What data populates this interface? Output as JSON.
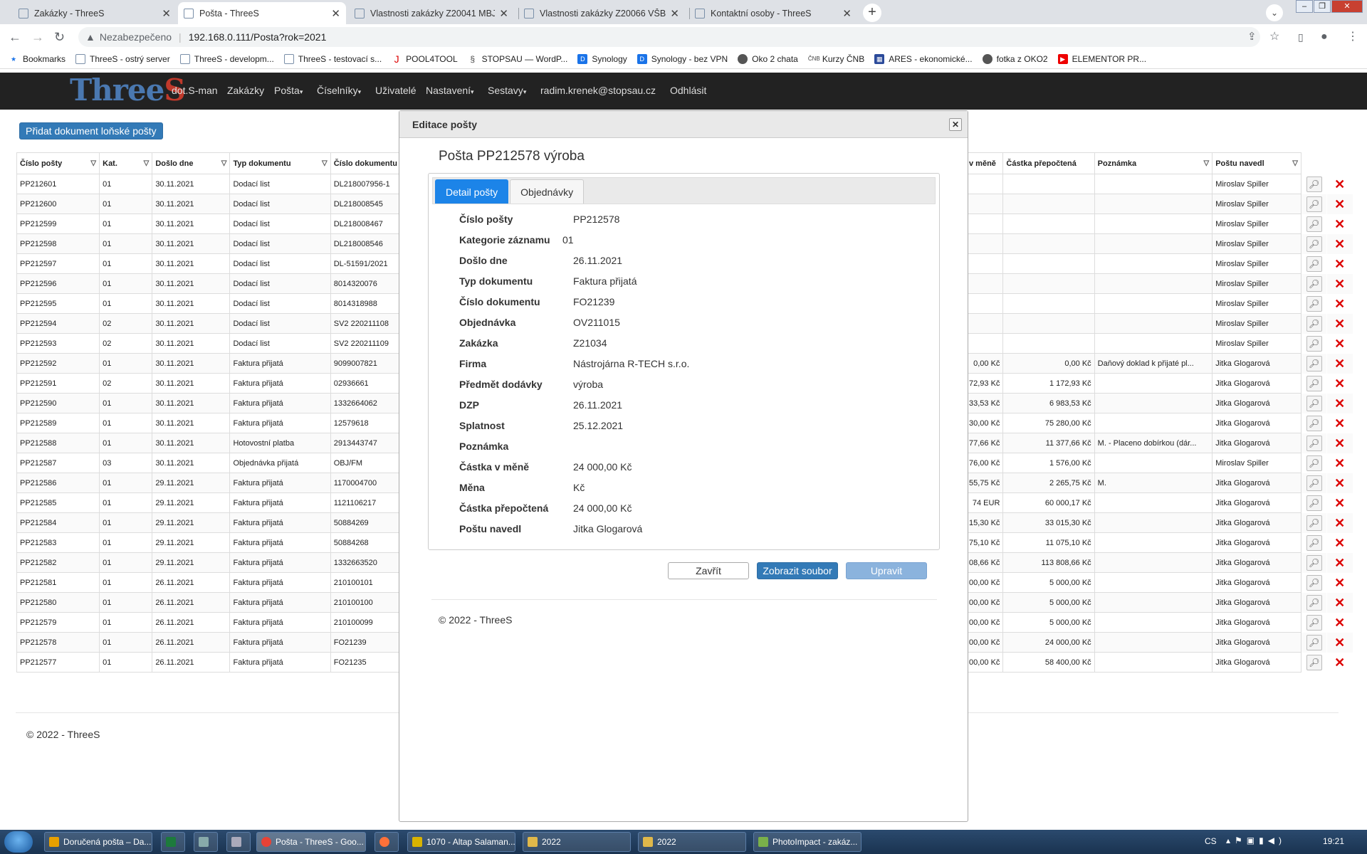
{
  "browser": {
    "tabs": [
      {
        "title": "Zakázky - ThreeS",
        "active": false
      },
      {
        "title": "Pošta - ThreeS",
        "active": true
      },
      {
        "title": "Vlastnosti zakázky Z20041 MBJZ",
        "active": false
      },
      {
        "title": "Vlastnosti zakázky Z20066 VŠB -",
        "active": false
      },
      {
        "title": "Kontaktní osoby - ThreeS",
        "active": false
      }
    ],
    "security_label": "Nezabezpečeno",
    "url": "192.168.0.111/Posta?rok=2021",
    "bookmarks": [
      "Bookmarks",
      "ThreeS - ostrý server",
      "ThreeS - developm...",
      "ThreeS - testovací s...",
      "POOL4TOOL",
      "STOPSAU — WordP...",
      "Synology",
      "Synology - bez VPN",
      "Oko 2 chata",
      "Kurzy ČNB",
      "ARES - ekonomické...",
      "fotka z OKO2",
      "ELEMENTOR PR..."
    ]
  },
  "app": {
    "logo_main": "Three",
    "logo_accent": "S",
    "nav": [
      "dot.S-man",
      "Zakázky",
      "Pošta",
      "Číselníky",
      "Uživatelé",
      "Nastavení",
      "Sestavy",
      "radim.krenek@stopsau.cz",
      "Odhlásit"
    ]
  },
  "page": {
    "add_button": "Přidat dokument loňské pošty",
    "footer": "© 2022 - ThreeS"
  },
  "grid_left": {
    "headers": [
      "Číslo pošty",
      "Kat.",
      "Došlo dne",
      "Typ dokumentu",
      "Číslo dokumentu"
    ],
    "rows": [
      [
        "PP212601",
        "01",
        "30.11.2021",
        "Dodací list",
        "DL218007956-1"
      ],
      [
        "PP212600",
        "01",
        "30.11.2021",
        "Dodací list",
        "DL218008545"
      ],
      [
        "PP212599",
        "01",
        "30.11.2021",
        "Dodací list",
        "DL218008467"
      ],
      [
        "PP212598",
        "01",
        "30.11.2021",
        "Dodací list",
        "DL218008546"
      ],
      [
        "PP212597",
        "01",
        "30.11.2021",
        "Dodací list",
        "DL-51591/2021"
      ],
      [
        "PP212596",
        "01",
        "30.11.2021",
        "Dodací list",
        "8014320076"
      ],
      [
        "PP212595",
        "01",
        "30.11.2021",
        "Dodací list",
        "8014318988"
      ],
      [
        "PP212594",
        "02",
        "30.11.2021",
        "Dodací list",
        "SV2 220211108"
      ],
      [
        "PP212593",
        "02",
        "30.11.2021",
        "Dodací list",
        "SV2 220211109"
      ],
      [
        "PP212592",
        "01",
        "30.11.2021",
        "Faktura přijatá",
        "9099007821"
      ],
      [
        "PP212591",
        "02",
        "30.11.2021",
        "Faktura přijatá",
        "02936661"
      ],
      [
        "PP212590",
        "01",
        "30.11.2021",
        "Faktura přijatá",
        "1332664062"
      ],
      [
        "PP212589",
        "01",
        "30.11.2021",
        "Faktura přijatá",
        "12579618"
      ],
      [
        "PP212588",
        "01",
        "30.11.2021",
        "Hotovostní platba",
        "2913443747"
      ],
      [
        "PP212587",
        "03",
        "30.11.2021",
        "Objednávka přijatá",
        "OBJ/FM"
      ],
      [
        "PP212586",
        "01",
        "29.11.2021",
        "Faktura přijatá",
        "1170004700"
      ],
      [
        "PP212585",
        "01",
        "29.11.2021",
        "Faktura přijatá",
        "1121106217"
      ],
      [
        "PP212584",
        "01",
        "29.11.2021",
        "Faktura přijatá",
        "50884269"
      ],
      [
        "PP212583",
        "01",
        "29.11.2021",
        "Faktura přijatá",
        "50884268"
      ],
      [
        "PP212582",
        "01",
        "29.11.2021",
        "Faktura přijatá",
        "1332663520"
      ],
      [
        "PP212581",
        "01",
        "26.11.2021",
        "Faktura přijatá",
        "210100101"
      ],
      [
        "PP212580",
        "01",
        "26.11.2021",
        "Faktura přijatá",
        "210100100"
      ],
      [
        "PP212579",
        "01",
        "26.11.2021",
        "Faktura přijatá",
        "210100099"
      ],
      [
        "PP212578",
        "01",
        "26.11.2021",
        "Faktura přijatá",
        "FO21239"
      ],
      [
        "PP212577",
        "01",
        "26.11.2021",
        "Faktura přijatá",
        "FO21235"
      ]
    ]
  },
  "grid_right": {
    "headers": [
      "v měně",
      "Částka přepočtená",
      "Poznámka",
      "Poštu navedl"
    ],
    "rows": [
      [
        "",
        "",
        "",
        "Miroslav Spiller"
      ],
      [
        "",
        "",
        "",
        "Miroslav Spiller"
      ],
      [
        "",
        "",
        "",
        "Miroslav Spiller"
      ],
      [
        "",
        "",
        "",
        "Miroslav Spiller"
      ],
      [
        "",
        "",
        "",
        "Miroslav Spiller"
      ],
      [
        "",
        "",
        "",
        "Miroslav Spiller"
      ],
      [
        "",
        "",
        "",
        "Miroslav Spiller"
      ],
      [
        "",
        "",
        "",
        "Miroslav Spiller"
      ],
      [
        "",
        "",
        "",
        "Miroslav Spiller"
      ],
      [
        "0,00 Kč",
        "0,00 Kč",
        "Daňový doklad k přijaté pl...",
        "Jitka Glogarová"
      ],
      [
        "72,93 Kč",
        "1 172,93 Kč",
        "",
        "Jitka Glogarová"
      ],
      [
        "33,53 Kč",
        "6 983,53 Kč",
        "",
        "Jitka Glogarová"
      ],
      [
        "30,00 Kč",
        "75 280,00 Kč",
        "",
        "Jitka Glogarová"
      ],
      [
        "77,66 Kč",
        "11 377,66 Kč",
        "M. - Placeno dobírkou (dár...",
        "Jitka Glogarová"
      ],
      [
        "76,00 Kč",
        "1 576,00 Kč",
        "",
        "Miroslav Spiller"
      ],
      [
        "55,75 Kč",
        "2 265,75 Kč",
        "M.",
        "Jitka Glogarová"
      ],
      [
        "74 EUR",
        "60 000,17 Kč",
        "",
        "Jitka Glogarová"
      ],
      [
        "15,30 Kč",
        "33 015,30 Kč",
        "",
        "Jitka Glogarová"
      ],
      [
        "75,10 Kč",
        "11 075,10 Kč",
        "",
        "Jitka Glogarová"
      ],
      [
        "08,66 Kč",
        "113 808,66 Kč",
        "",
        "Jitka Glogarová"
      ],
      [
        "00,00 Kč",
        "5 000,00 Kč",
        "",
        "Jitka Glogarová"
      ],
      [
        "00,00 Kč",
        "5 000,00 Kč",
        "",
        "Jitka Glogarová"
      ],
      [
        "00,00 Kč",
        "5 000,00 Kč",
        "",
        "Jitka Glogarová"
      ],
      [
        "00,00 Kč",
        "24 000,00 Kč",
        "",
        "Jitka Glogarová"
      ],
      [
        "00,00 Kč",
        "58 400,00 Kč",
        "",
        "Jitka Glogarová"
      ]
    ]
  },
  "modal": {
    "title": "Editace pošty",
    "heading": "Pošta PP212578 výroba",
    "tabs": [
      "Detail pošty",
      "Objednávky"
    ],
    "fields": [
      {
        "label": "Číslo pošty",
        "value": "PP212578"
      },
      {
        "label": "Kategorie záznamu",
        "value": "01"
      },
      {
        "label": "Došlo dne",
        "value": "26.11.2021"
      },
      {
        "label": "Typ dokumentu",
        "value": "Faktura přijatá"
      },
      {
        "label": "Číslo dokumentu",
        "value": "FO21239"
      },
      {
        "label": "Objednávka",
        "value": "OV211015"
      },
      {
        "label": "Zakázka",
        "value": "Z21034"
      },
      {
        "label": "Firma",
        "value": "Nástrojárna R-TECH s.r.o."
      },
      {
        "label": "Předmět dodávky",
        "value": "výroba"
      },
      {
        "label": "DZP",
        "value": "26.11.2021"
      },
      {
        "label": "Splatnost",
        "value": "25.12.2021"
      },
      {
        "label": "Poznámka",
        "value": ""
      },
      {
        "label": "Částka v měně",
        "value": "24 000,00 Kč"
      },
      {
        "label": "Měna",
        "value": "Kč"
      },
      {
        "label": "Částka přepočtená",
        "value": "24 000,00 Kč"
      },
      {
        "label": "Poštu navedl",
        "value": "Jitka Glogarová"
      }
    ],
    "buttons": {
      "close": "Zavřít",
      "show_file": "Zobrazit soubor",
      "edit": "Upravit"
    },
    "footer": "© 2022 - ThreeS"
  },
  "taskbar": {
    "items": [
      "Doručená pošta – Da...",
      "",
      "",
      "",
      "Pošta - ThreeS - Goo...",
      "",
      "1070 - Altap Salaman...",
      "2022",
      "2022",
      "PhotoImpact - zakáz..."
    ],
    "language": "CS",
    "time": "19:21"
  }
}
